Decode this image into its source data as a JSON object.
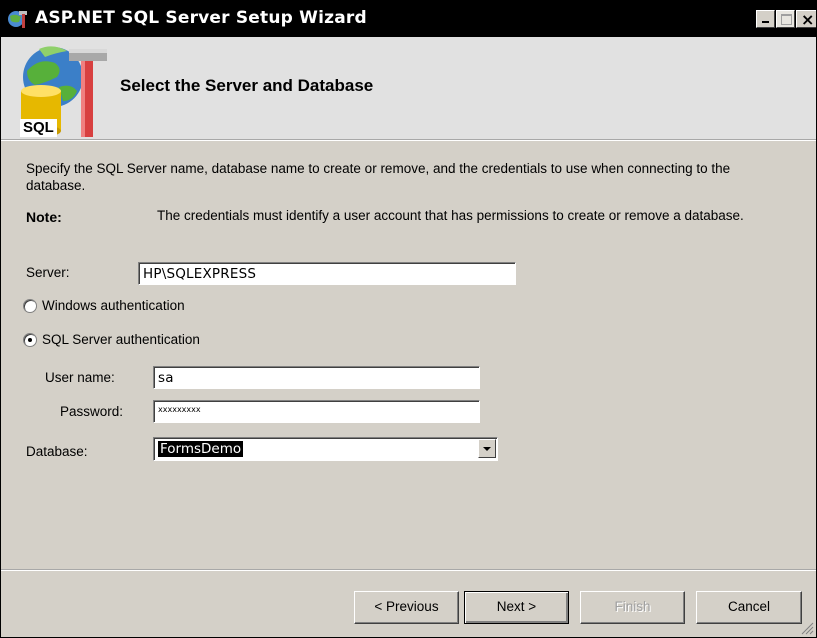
{
  "window": {
    "title": "ASP.NET SQL Server Setup Wizard",
    "close_glyph": "×"
  },
  "header": {
    "heading": "Select the Server and Database",
    "logo_icon": "sql-database-hammer-icon",
    "logo_text": "SQL"
  },
  "content": {
    "description": "Specify the SQL Server name, database name to create or remove, and the credentials to use when connecting to the database.",
    "note_label": "Note:",
    "note_text": "The credentials must identify a user account that has permissions to create or remove a database."
  },
  "form": {
    "server_label": "Server:",
    "server_value": "HP\\SQLEXPRESS",
    "windows_auth_label": "Windows authentication",
    "windows_auth_selected": false,
    "sql_auth_label": "SQL Server authentication",
    "sql_auth_selected": true,
    "username_label": "User name:",
    "username_value": "sa",
    "password_label": "Password:",
    "password_value": "xxxxxxxxx",
    "database_label": "Database:",
    "database_value": "FormsDemo"
  },
  "buttons": {
    "previous": "< Previous",
    "next": "Next >",
    "finish": "Finish",
    "cancel": "Cancel"
  },
  "colors": {
    "window_bg": "#d4d0c8",
    "header_bg": "#e1e1e1",
    "titlebar_bg": "#000000",
    "selection_bg": "#000000"
  }
}
